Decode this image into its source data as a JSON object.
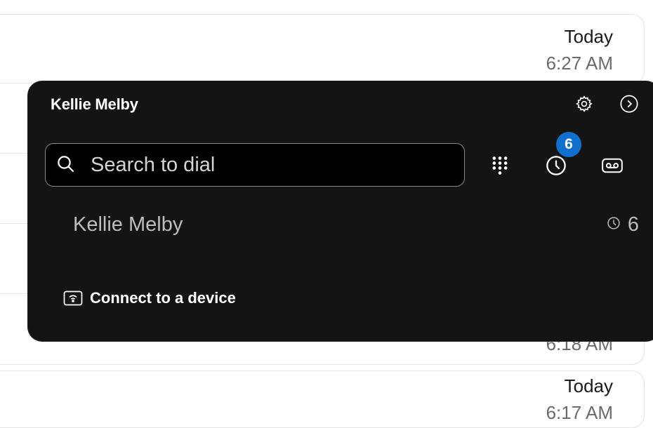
{
  "background": {
    "items": [
      {
        "date": "Today",
        "time": "6:27 AM"
      },
      {
        "date": "",
        "time": "6:18 AM"
      },
      {
        "date": "Today",
        "time": "6:17 AM"
      }
    ]
  },
  "panel": {
    "title": "Kellie Melby",
    "search": {
      "placeholder": "Search to dial",
      "value": ""
    },
    "history_badge": "6",
    "contact": {
      "name": "Kellie Melby",
      "count": "6"
    },
    "connect_label": "Connect to a device"
  },
  "colors": {
    "panel_bg": "#141414",
    "badge": "#1170cf",
    "accent_text": "#bdbdbd"
  },
  "icons": [
    "gear-icon",
    "chevron-right-icon",
    "search-icon",
    "dialpad-icon",
    "clock-icon",
    "voicemail-icon",
    "device-icon"
  ]
}
